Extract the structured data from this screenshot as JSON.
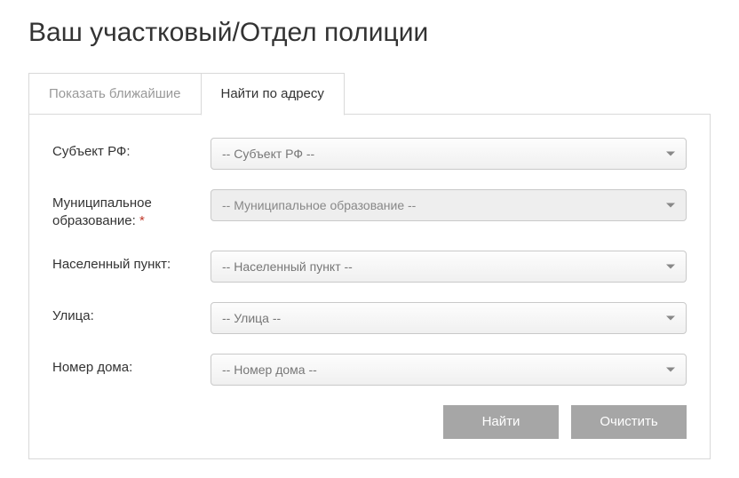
{
  "page_title": "Ваш участковый/Отдел полиции",
  "tabs": {
    "nearest": "Показать ближайшие",
    "by_address": "Найти по адресу"
  },
  "form": {
    "subject": {
      "label": "Субъект РФ:",
      "placeholder": "-- Субъект РФ --"
    },
    "municipality": {
      "label": "Муниципальное образование:",
      "required_mark": "*",
      "placeholder": "-- Муниципальное образование --"
    },
    "locality": {
      "label": "Населенный пункт:",
      "placeholder": "-- Населенный пункт --"
    },
    "street": {
      "label": "Улица:",
      "placeholder": "-- Улица --"
    },
    "house": {
      "label": "Номер дома:",
      "placeholder": "-- Номер дома --"
    }
  },
  "buttons": {
    "find": "Найти",
    "clear": "Очистить"
  }
}
